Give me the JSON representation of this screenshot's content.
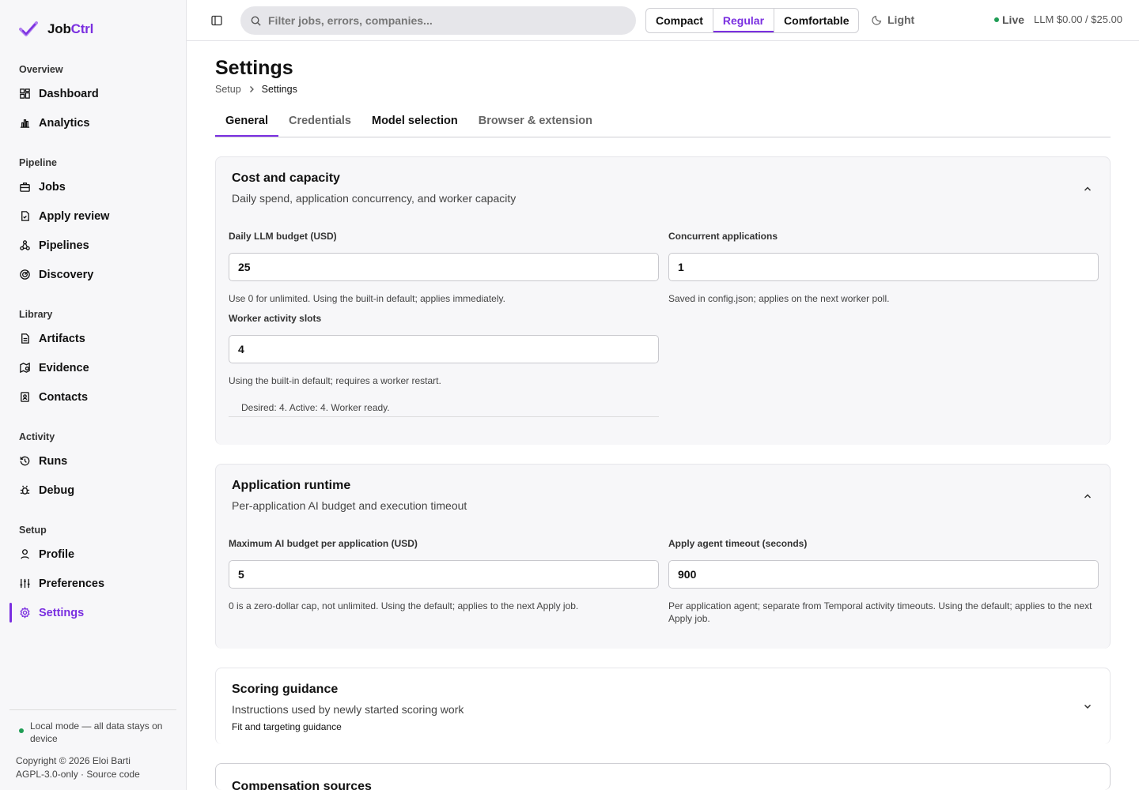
{
  "brand": {
    "name_a": "Job",
    "name_b": "Ctrl",
    "accent": "#7a2fe0"
  },
  "sidebar": {
    "groups": [
      {
        "heading": "Overview",
        "items": [
          {
            "label": "Dashboard",
            "icon": "dashboard-icon"
          },
          {
            "label": "Analytics",
            "icon": "bar-chart-icon"
          }
        ]
      },
      {
        "heading": "Pipeline",
        "items": [
          {
            "label": "Jobs",
            "icon": "briefcase-icon"
          },
          {
            "label": "Apply review",
            "icon": "clipboard-check-icon"
          },
          {
            "label": "Pipelines",
            "icon": "workflow-icon"
          },
          {
            "label": "Discovery",
            "icon": "radar-icon"
          }
        ]
      },
      {
        "heading": "Library",
        "items": [
          {
            "label": "Artifacts",
            "icon": "document-icon"
          },
          {
            "label": "Evidence",
            "icon": "map-search-icon"
          },
          {
            "label": "Contacts",
            "icon": "contact-card-icon"
          }
        ]
      },
      {
        "heading": "Activity",
        "items": [
          {
            "label": "Runs",
            "icon": "history-icon"
          },
          {
            "label": "Debug",
            "icon": "bug-icon"
          }
        ]
      },
      {
        "heading": "Setup",
        "items": [
          {
            "label": "Profile",
            "icon": "user-icon"
          },
          {
            "label": "Preferences",
            "icon": "sliders-icon"
          },
          {
            "label": "Settings",
            "icon": "gear-icon",
            "active": true
          }
        ]
      }
    ],
    "footer": {
      "local_mode": "Local mode — all data stays on device",
      "copyright": "Copyright © 2026 Eloi Barti",
      "license": "AGPL-3.0-only · Source code"
    }
  },
  "topbar": {
    "search_placeholder": "Filter jobs, errors, companies...",
    "density": [
      "Compact",
      "Regular",
      "Comfortable"
    ],
    "density_selected": "Regular",
    "theme_label": "Light",
    "live_label": "Live",
    "llm_usage": "LLM $0.00 / $25.00"
  },
  "page": {
    "title": "Settings",
    "breadcrumb": [
      "Setup",
      "Settings"
    ],
    "tabs": [
      "General",
      "Credentials",
      "Model selection",
      "Browser & extension"
    ],
    "tab_selected": "General"
  },
  "cards": {
    "cost": {
      "title": "Cost and capacity",
      "subtitle": "Daily spend, application concurrency, and worker capacity",
      "daily_budget": {
        "label": "Daily LLM budget (USD)",
        "value": "25",
        "help": "Use 0 for unlimited. Using the built-in default; applies immediately."
      },
      "concurrent": {
        "label": "Concurrent applications",
        "value": "1",
        "help": "Saved in config.json; applies on the next worker poll."
      },
      "slots": {
        "label": "Worker activity slots",
        "value": "4",
        "help": "Using the built-in default; requires a worker restart."
      },
      "status": "Desired: 4. Active: 4. Worker ready."
    },
    "runtime": {
      "title": "Application runtime",
      "subtitle": "Per-application AI budget and execution timeout",
      "max_budget": {
        "label": "Maximum AI budget per application (USD)",
        "value": "5",
        "help": "0 is a zero-dollar cap, not unlimited. Using the default; applies to the next Apply job."
      },
      "timeout": {
        "label": "Apply agent timeout (seconds)",
        "value": "900",
        "help": "Per application agent; separate from Temporal activity timeouts. Using the default; applies to the next Apply job."
      }
    },
    "scoring": {
      "title": "Scoring guidance",
      "subtitle": "Instructions used by newly started scoring work",
      "extra": "Fit and targeting guidance"
    },
    "compensation": {
      "title": "Compensation sources"
    }
  }
}
